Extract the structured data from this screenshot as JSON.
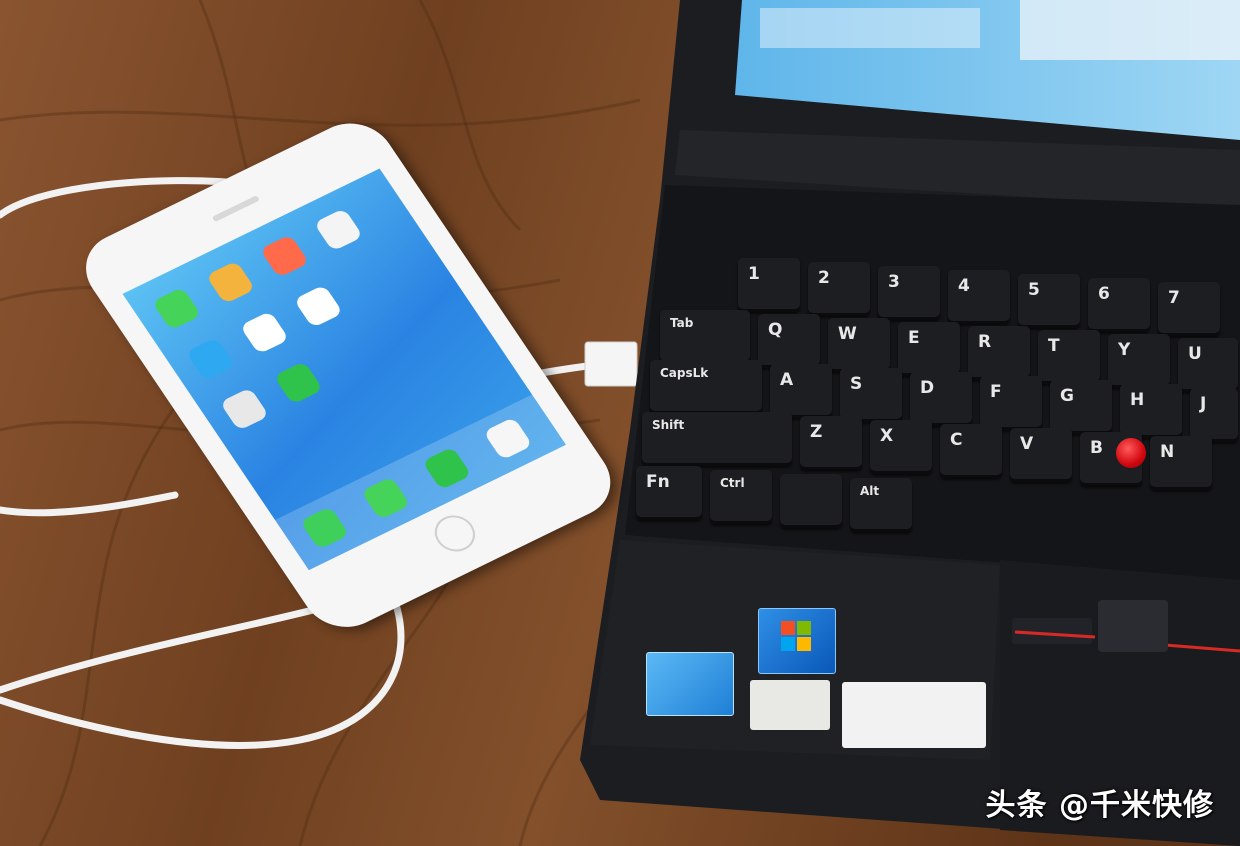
{
  "scene": {
    "description_free": true,
    "colors": {
      "wood": "#7a4a26",
      "wood_dark": "#4a2a12",
      "phone_body": "#f4f4f4",
      "phone_screen": "#2f8fe6",
      "laptop": "#1c1d21",
      "trackpoint": "#e0141a",
      "cable": "#f2f2f2"
    }
  },
  "keyboard": {
    "row1": [
      "1",
      "2",
      "3",
      "4",
      "5",
      "6",
      "7"
    ],
    "row2": [
      "Tab",
      "Q",
      "W",
      "E",
      "R",
      "T",
      "Y",
      "U"
    ],
    "row3": [
      "CapsLk",
      "A",
      "S",
      "D",
      "F",
      "G",
      "H",
      "J"
    ],
    "row4": [
      "Shift",
      "Z",
      "X",
      "C",
      "V",
      "B",
      "N"
    ],
    "row5": [
      "Fn",
      "Ctrl",
      "",
      "Alt"
    ]
  },
  "watermark": "头条 @千米快修",
  "icons": [
    "phone-icon",
    "messages-icon",
    "wechat-icon",
    "qq-icon",
    "windows-logo-icon",
    "intel-logo-icon"
  ]
}
